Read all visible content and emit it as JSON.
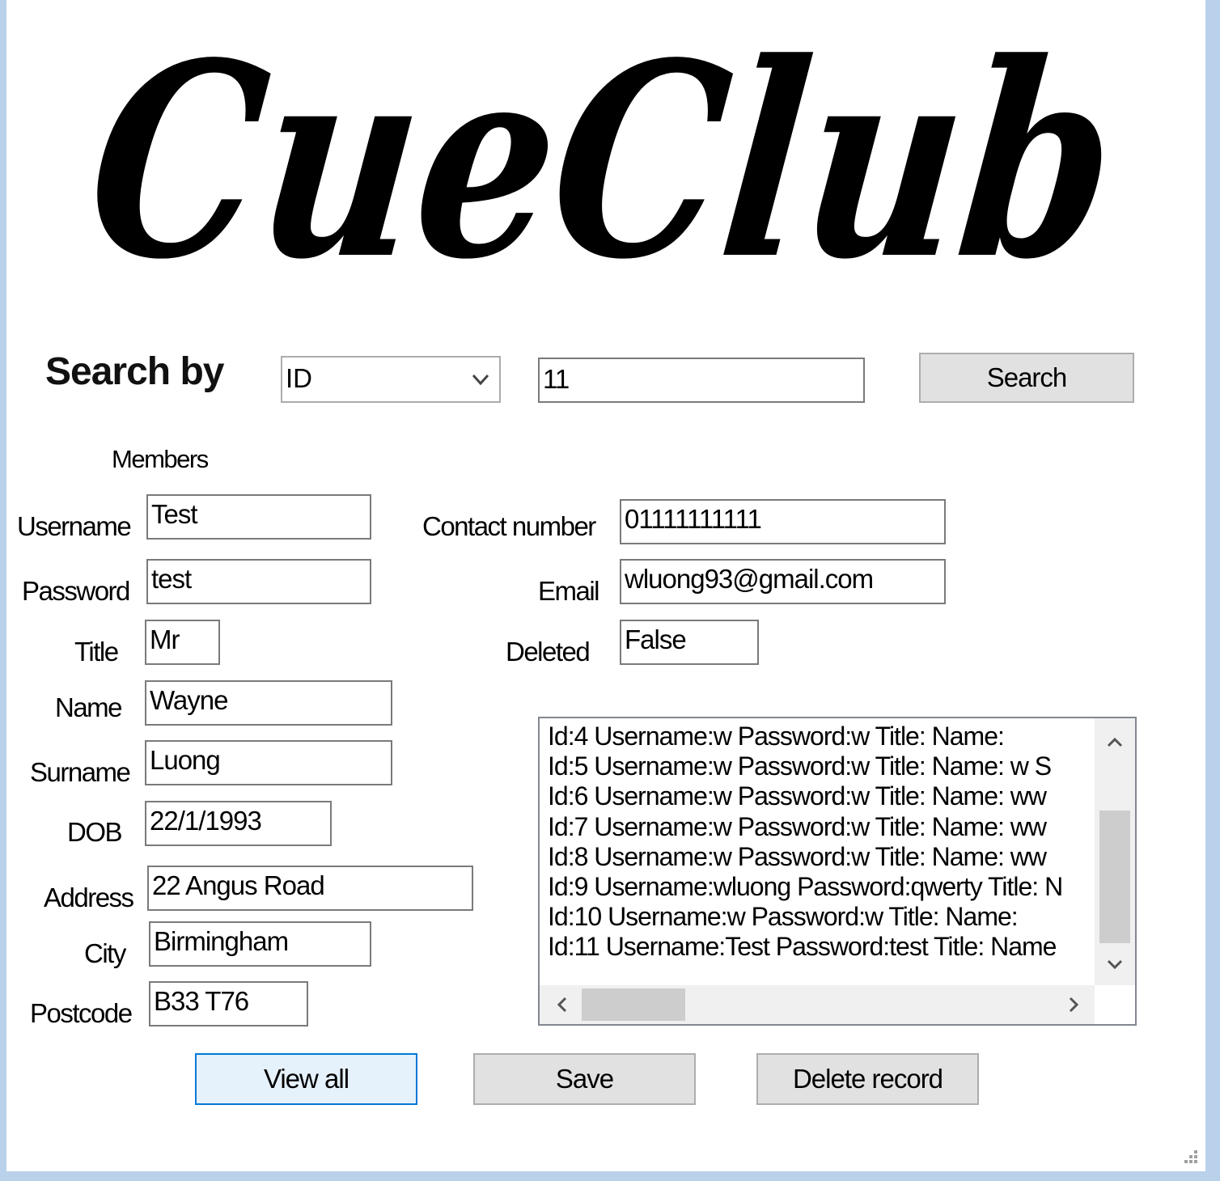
{
  "logo": {
    "text": "CueClub"
  },
  "search": {
    "label": "Search by",
    "field_selected": "ID",
    "value": "11",
    "button_label": "Search"
  },
  "members": {
    "group_label": "Members",
    "username": {
      "label": "Username",
      "value": "Test"
    },
    "password": {
      "label": "Password",
      "value": "test"
    },
    "title": {
      "label": "Title",
      "value": "Mr"
    },
    "name": {
      "label": "Name",
      "value": "Wayne"
    },
    "surname": {
      "label": "Surname",
      "value": "Luong"
    },
    "dob": {
      "label": "DOB",
      "value": "22/1/1993"
    },
    "address": {
      "label": "Address",
      "value": "22 Angus Road"
    },
    "city": {
      "label": "City",
      "value": "Birmingham"
    },
    "postcode": {
      "label": "Postcode",
      "value": "B33 T76"
    },
    "contact": {
      "label": "Contact number",
      "value": "01111111111"
    },
    "email": {
      "label": "Email",
      "value": "wluong93@gmail.com"
    },
    "deleted": {
      "label": "Deleted",
      "value": "False"
    }
  },
  "records": [
    "Id:4 Username:w  Password:w  Title:    Name:",
    "Id:5 Username:w  Password:w  Title:    Name: w S",
    "Id:6 Username:w  Password:w  Title:    Name: ww",
    "Id:7 Username:w  Password:w  Title:    Name: ww",
    "Id:8 Username:w  Password:w  Title:    Name: ww",
    "Id:9 Username:wluong  Password:qwerty  Title:   N",
    "Id:10 Username:w  Password:w  Title:    Name:",
    "Id:11 Username:Test  Password:test  Title:    Name"
  ],
  "actions": {
    "view_all": "View all",
    "save": "Save",
    "delete": "Delete record"
  },
  "icons": {
    "dropdown": "chevron-down-icon",
    "scroll_up": "chevron-up-icon",
    "scroll_down": "chevron-down-icon",
    "scroll_left": "chevron-left-icon",
    "scroll_right": "chevron-right-icon",
    "resize": "resize-grip-icon"
  },
  "colors": {
    "window_border": "#b9d1ea",
    "button_bg": "#e1e1e1",
    "focus_border": "#0078d7",
    "scroll_track": "#f0f0f0",
    "scroll_thumb": "#cdcdcd"
  }
}
